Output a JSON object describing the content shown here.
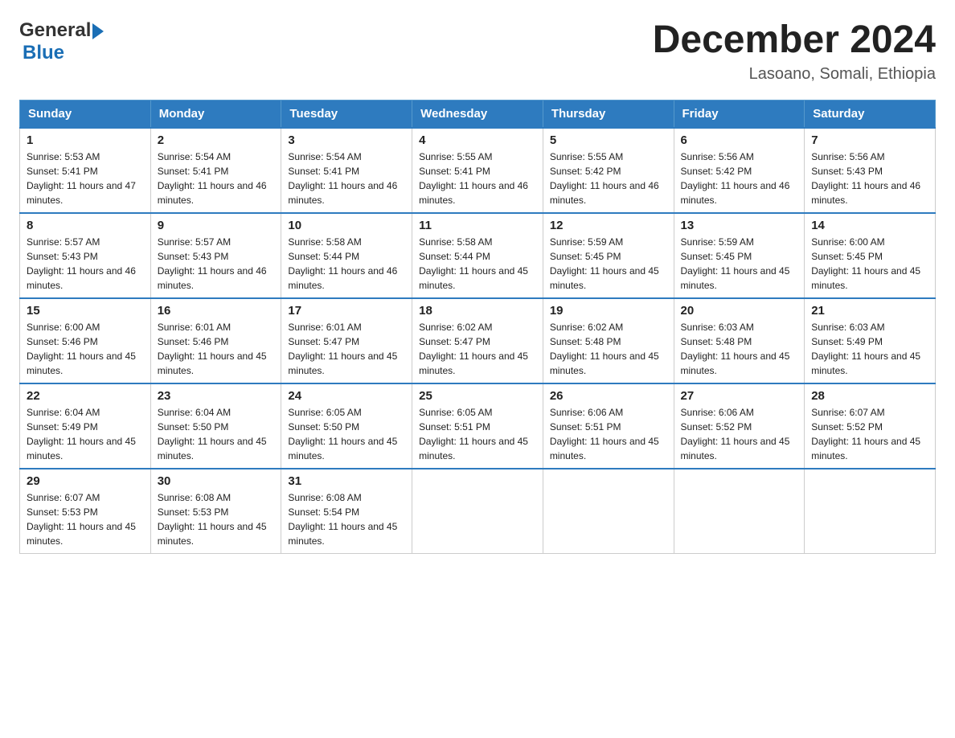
{
  "header": {
    "logo_general": "General",
    "logo_blue": "Blue",
    "month_title": "December 2024",
    "subtitle": "Lasoano, Somali, Ethiopia"
  },
  "weekdays": [
    "Sunday",
    "Monday",
    "Tuesday",
    "Wednesday",
    "Thursday",
    "Friday",
    "Saturday"
  ],
  "weeks": [
    [
      {
        "day": "1",
        "sunrise": "5:53 AM",
        "sunset": "5:41 PM",
        "daylight": "11 hours and 47 minutes."
      },
      {
        "day": "2",
        "sunrise": "5:54 AM",
        "sunset": "5:41 PM",
        "daylight": "11 hours and 46 minutes."
      },
      {
        "day": "3",
        "sunrise": "5:54 AM",
        "sunset": "5:41 PM",
        "daylight": "11 hours and 46 minutes."
      },
      {
        "day": "4",
        "sunrise": "5:55 AM",
        "sunset": "5:41 PM",
        "daylight": "11 hours and 46 minutes."
      },
      {
        "day": "5",
        "sunrise": "5:55 AM",
        "sunset": "5:42 PM",
        "daylight": "11 hours and 46 minutes."
      },
      {
        "day": "6",
        "sunrise": "5:56 AM",
        "sunset": "5:42 PM",
        "daylight": "11 hours and 46 minutes."
      },
      {
        "day": "7",
        "sunrise": "5:56 AM",
        "sunset": "5:43 PM",
        "daylight": "11 hours and 46 minutes."
      }
    ],
    [
      {
        "day": "8",
        "sunrise": "5:57 AM",
        "sunset": "5:43 PM",
        "daylight": "11 hours and 46 minutes."
      },
      {
        "day": "9",
        "sunrise": "5:57 AM",
        "sunset": "5:43 PM",
        "daylight": "11 hours and 46 minutes."
      },
      {
        "day": "10",
        "sunrise": "5:58 AM",
        "sunset": "5:44 PM",
        "daylight": "11 hours and 46 minutes."
      },
      {
        "day": "11",
        "sunrise": "5:58 AM",
        "sunset": "5:44 PM",
        "daylight": "11 hours and 45 minutes."
      },
      {
        "day": "12",
        "sunrise": "5:59 AM",
        "sunset": "5:45 PM",
        "daylight": "11 hours and 45 minutes."
      },
      {
        "day": "13",
        "sunrise": "5:59 AM",
        "sunset": "5:45 PM",
        "daylight": "11 hours and 45 minutes."
      },
      {
        "day": "14",
        "sunrise": "6:00 AM",
        "sunset": "5:45 PM",
        "daylight": "11 hours and 45 minutes."
      }
    ],
    [
      {
        "day": "15",
        "sunrise": "6:00 AM",
        "sunset": "5:46 PM",
        "daylight": "11 hours and 45 minutes."
      },
      {
        "day": "16",
        "sunrise": "6:01 AM",
        "sunset": "5:46 PM",
        "daylight": "11 hours and 45 minutes."
      },
      {
        "day": "17",
        "sunrise": "6:01 AM",
        "sunset": "5:47 PM",
        "daylight": "11 hours and 45 minutes."
      },
      {
        "day": "18",
        "sunrise": "6:02 AM",
        "sunset": "5:47 PM",
        "daylight": "11 hours and 45 minutes."
      },
      {
        "day": "19",
        "sunrise": "6:02 AM",
        "sunset": "5:48 PM",
        "daylight": "11 hours and 45 minutes."
      },
      {
        "day": "20",
        "sunrise": "6:03 AM",
        "sunset": "5:48 PM",
        "daylight": "11 hours and 45 minutes."
      },
      {
        "day": "21",
        "sunrise": "6:03 AM",
        "sunset": "5:49 PM",
        "daylight": "11 hours and 45 minutes."
      }
    ],
    [
      {
        "day": "22",
        "sunrise": "6:04 AM",
        "sunset": "5:49 PM",
        "daylight": "11 hours and 45 minutes."
      },
      {
        "day": "23",
        "sunrise": "6:04 AM",
        "sunset": "5:50 PM",
        "daylight": "11 hours and 45 minutes."
      },
      {
        "day": "24",
        "sunrise": "6:05 AM",
        "sunset": "5:50 PM",
        "daylight": "11 hours and 45 minutes."
      },
      {
        "day": "25",
        "sunrise": "6:05 AM",
        "sunset": "5:51 PM",
        "daylight": "11 hours and 45 minutes."
      },
      {
        "day": "26",
        "sunrise": "6:06 AM",
        "sunset": "5:51 PM",
        "daylight": "11 hours and 45 minutes."
      },
      {
        "day": "27",
        "sunrise": "6:06 AM",
        "sunset": "5:52 PM",
        "daylight": "11 hours and 45 minutes."
      },
      {
        "day": "28",
        "sunrise": "6:07 AM",
        "sunset": "5:52 PM",
        "daylight": "11 hours and 45 minutes."
      }
    ],
    [
      {
        "day": "29",
        "sunrise": "6:07 AM",
        "sunset": "5:53 PM",
        "daylight": "11 hours and 45 minutes."
      },
      {
        "day": "30",
        "sunrise": "6:08 AM",
        "sunset": "5:53 PM",
        "daylight": "11 hours and 45 minutes."
      },
      {
        "day": "31",
        "sunrise": "6:08 AM",
        "sunset": "5:54 PM",
        "daylight": "11 hours and 45 minutes."
      },
      null,
      null,
      null,
      null
    ]
  ]
}
